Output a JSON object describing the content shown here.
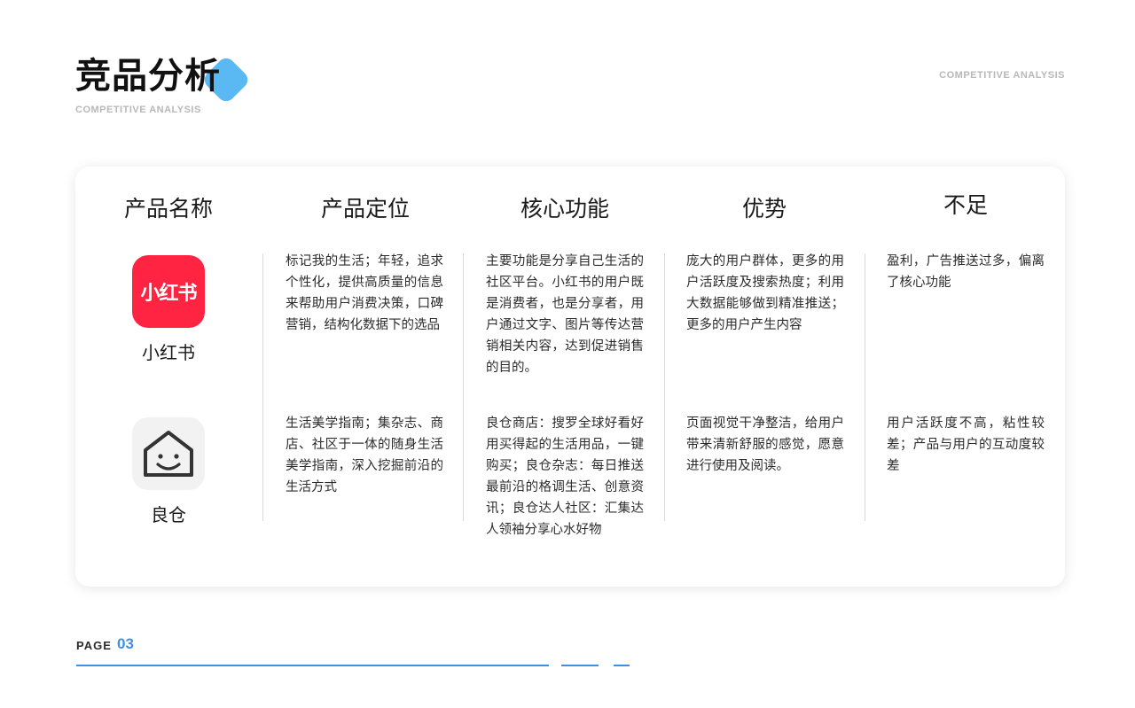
{
  "header": {
    "title": "竞品分析",
    "subtitle": "COMPETITIVE ANALYSIS",
    "corner_label": "COMPETITIVE ANALYSIS",
    "accent_color": "#5ab8f3"
  },
  "table": {
    "columns": [
      "产品名称",
      "产品定位",
      "核心功能",
      "优势",
      "不足"
    ],
    "rows": [
      {
        "product": "小红书",
        "icon_text": "小红书",
        "icon": "xiaohongshu-logo-icon",
        "icon_color": "#ff2442",
        "positioning": "标记我的生活；年轻，追求个性化，提供高质量的信息来帮助用户消费决策，口碑营销，结构化数据下的选品",
        "core_function": "主要功能是分享自己生活的社区平台。小红书的用户既是消费者，也是分享者，用户通过文字、图片等传达营销相关内容，达到促进销售的目的。",
        "advantage": "庞大的用户群体，更多的用户活跃度及搜索热度；利用大数据能够做到精准推送；更多的用户产生内容",
        "weakness": "盈利，广告推送过多，偏离了核心功能"
      },
      {
        "product": "良仓",
        "icon": "house-smile-icon",
        "icon_color": "#f2f2f2",
        "positioning": "生活美学指南；集杂志、商店、社区于一体的随身生活美学指南，深入挖掘前沿的生活方式",
        "core_function": "良仓商店：搜罗全球好看好用买得起的生活用品，一键购买；良仓杂志：每日推送最前沿的格调生活、创意资讯；良仓达人社区：汇集达人领袖分享心水好物",
        "advantage": "页面视觉干净整洁，给用户带来清新舒服的感觉，愿意进行使用及阅读。",
        "weakness": "用户活跃度不高，粘性较差；产品与用户的互动度较差"
      }
    ]
  },
  "footer": {
    "page_label": "PAGE",
    "page_number": "03",
    "accent_color": "#3f8fe6"
  }
}
